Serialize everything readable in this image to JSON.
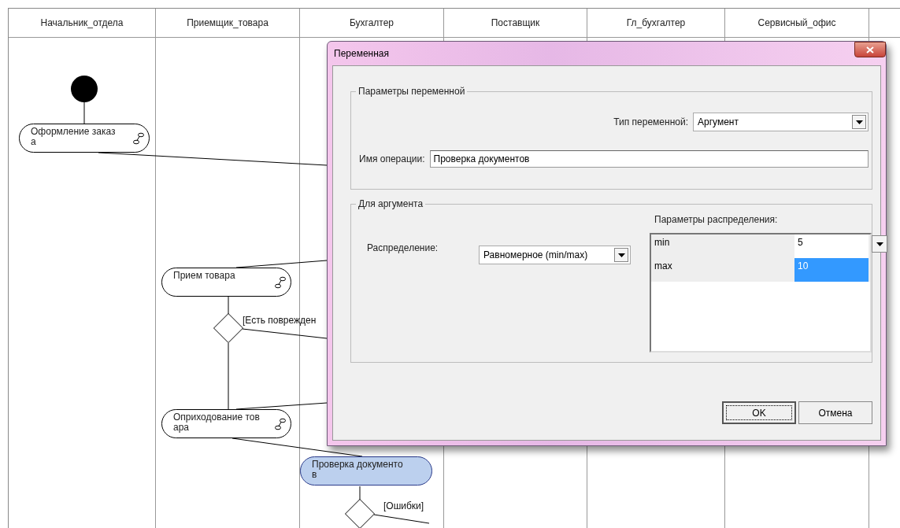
{
  "lanes": [
    "Начальник_отдела",
    "Приемщик_товара",
    "Бухгалтер",
    "Поставщик",
    "Гл_бухгалтер",
    "Сервисный_офис"
  ],
  "nodes": [
    {
      "kind": "start"
    },
    {
      "kind": "action",
      "lines": [
        "Оформление заказ",
        "а"
      ],
      "selected": false
    },
    {
      "kind": "action",
      "lines": [
        "Прием товара"
      ],
      "selected": false
    },
    {
      "kind": "decision",
      "guard": "[Есть поврежден"
    },
    {
      "kind": "action",
      "lines": [
        "Оприходование тов",
        "ара"
      ],
      "selected": false
    },
    {
      "kind": "action",
      "lines": [
        "Проверка документо",
        "в"
      ],
      "selected": true
    },
    {
      "kind": "decision",
      "guard": "[Ошибки]"
    }
  ],
  "dialog": {
    "title": "Переменная",
    "group_variable": {
      "title": "Параметры переменной",
      "type_label": "Тип переменной:",
      "type_value": "Аргумент",
      "name_label": "Имя операции:",
      "name_value": "Проверка документов"
    },
    "group_argument": {
      "title": "Для аргумента",
      "distribution_label": "Распределение:",
      "distribution_value": "Равномерное (min/max)",
      "params_label": "Параметры распределения:",
      "params": [
        {
          "name": "min",
          "value": "5",
          "selected": false,
          "editing": true
        },
        {
          "name": "max",
          "value": "10",
          "selected": true,
          "editing": false
        }
      ]
    },
    "buttons": [
      {
        "label": "OK",
        "default": true
      },
      {
        "label": "Отмена",
        "default": false
      }
    ]
  }
}
